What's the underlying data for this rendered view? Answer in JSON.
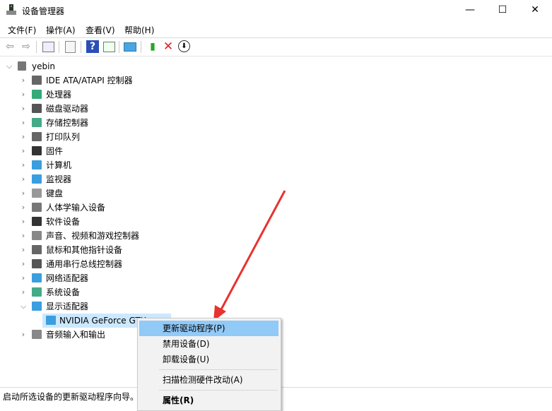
{
  "window": {
    "title": "设备管理器",
    "minimize": "—",
    "maximize": "☐",
    "close": "✕"
  },
  "menu": [
    "文件(F)",
    "操作(A)",
    "查看(V)",
    "帮助(H)"
  ],
  "toolbar": [
    "back-icon",
    "forward-icon",
    "properties-pane-icon",
    "list-icon",
    "help-icon",
    "view-icon",
    "scan-icon",
    "update-driver-icon",
    "uninstall-icon",
    "disable-icon"
  ],
  "tree": {
    "root": "yebin",
    "items": [
      "IDE ATA/ATAPI 控制器",
      "处理器",
      "磁盘驱动器",
      "存储控制器",
      "打印队列",
      "固件",
      "计算机",
      "监视器",
      "键盘",
      "人体学输入设备",
      "软件设备",
      "声音、视频和游戏控制器",
      "鼠标和其他指针设备",
      "通用串行总线控制器",
      "网络适配器",
      "系统设备",
      "显示适配器"
    ],
    "child": "NVIDIA GeForce GTX",
    "last": "音频输入和输出"
  },
  "context_menu": {
    "items": [
      "更新驱动程序(P)",
      "禁用设备(D)",
      "卸载设备(U)",
      "扫描检测硬件改动(A)",
      "属性(R)"
    ]
  },
  "status": "启动所选设备的更新驱动程序向导。",
  "colors": {
    "highlight": "#91c9f7",
    "selected": "#cce8ff",
    "arrow": "#e8322f"
  }
}
